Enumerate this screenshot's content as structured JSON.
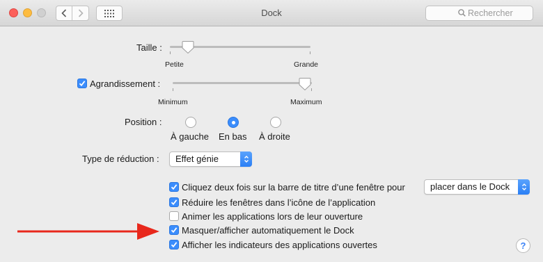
{
  "window": {
    "title": "Dock"
  },
  "toolbar": {
    "search_placeholder": "Rechercher"
  },
  "size": {
    "label": "Taille :",
    "min_label": "Petite",
    "max_label": "Grande",
    "value_fraction": 0.13
  },
  "magnification": {
    "label": "Agrandissement :",
    "checked": true,
    "min_label": "Minimum",
    "max_label": "Maximum",
    "value_fraction": 0.97
  },
  "position": {
    "label": "Position :",
    "options": [
      {
        "label": "À gauche",
        "selected": false
      },
      {
        "label": "En bas",
        "selected": true
      },
      {
        "label": "À droite",
        "selected": false
      }
    ]
  },
  "minimize": {
    "label": "Type de réduction :",
    "value": "Effet génie"
  },
  "options": [
    {
      "label": "Cliquez deux fois sur la barre de titre d’une fenêtre pour",
      "checked": true
    },
    {
      "label": "Réduire les fenêtres dans l’icône de l’application",
      "checked": true
    },
    {
      "label": "Animer les applications lors de leur ouverture",
      "checked": false
    },
    {
      "label": "Masquer/afficher automatiquement le Dock",
      "checked": true
    },
    {
      "label": "Afficher les indicateurs des applications ouvertes",
      "checked": true
    }
  ],
  "double_click_action": {
    "value": "placer dans le Dock"
  },
  "help": {
    "label": "?"
  },
  "colors": {
    "accent": "#3b8dfc",
    "annotation_arrow": "#e8281c"
  }
}
